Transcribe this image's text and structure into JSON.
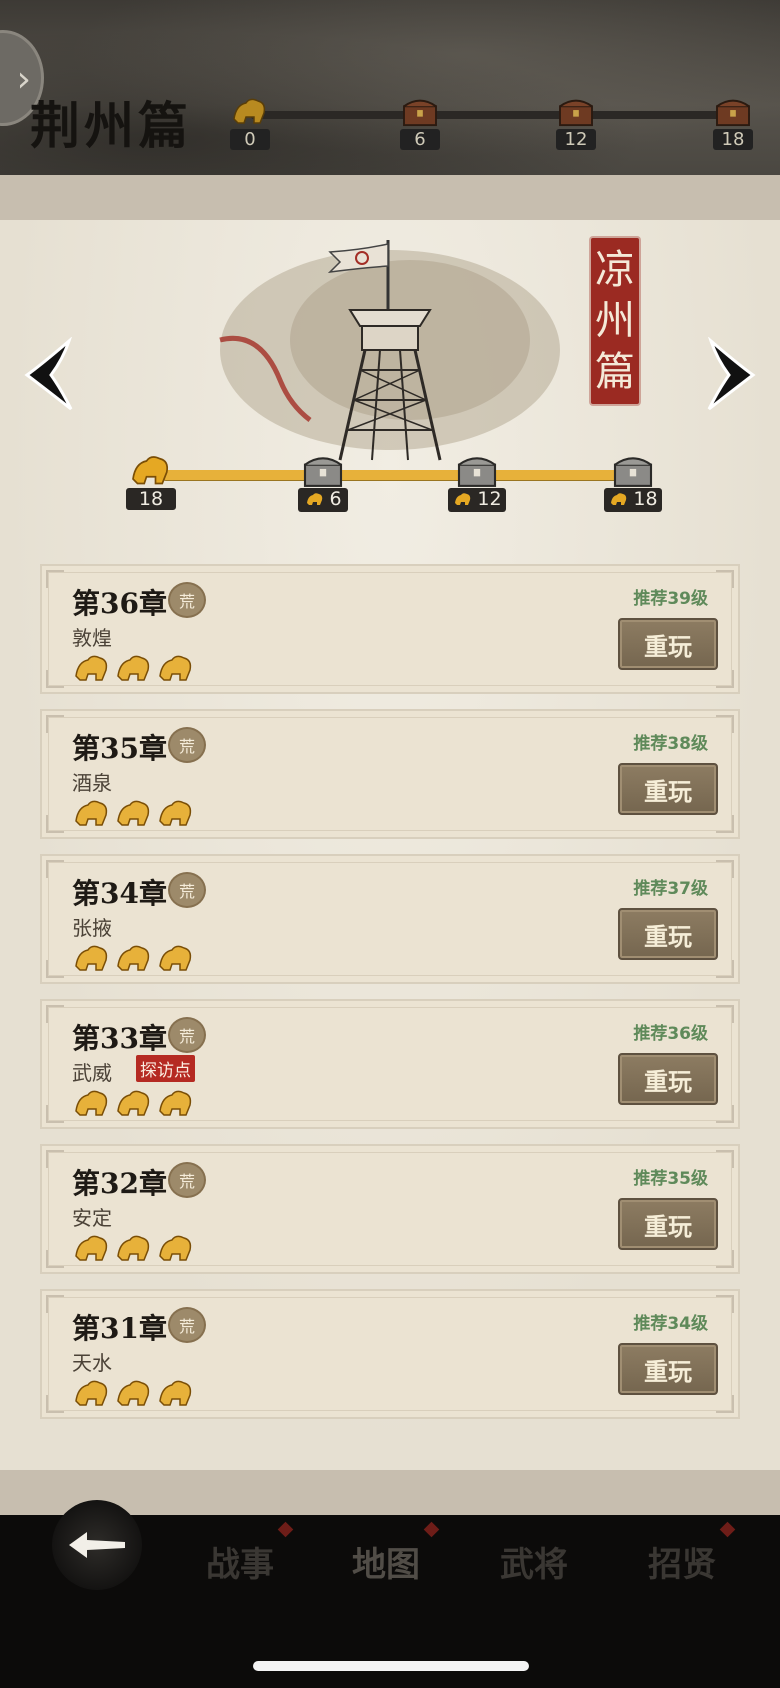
{
  "top_banner": {
    "chapter_title": "荆州篇",
    "nodes": [
      {
        "icon": "lion-icon",
        "value": "0"
      },
      {
        "icon": "chest-icon",
        "value": "6"
      },
      {
        "icon": "chest-icon",
        "value": "12"
      },
      {
        "icon": "chest-icon",
        "value": "18"
      }
    ]
  },
  "section": {
    "seal": [
      "凉",
      "州",
      "篇"
    ],
    "progress": {
      "current": "18",
      "milestones": [
        "6",
        "12",
        "18"
      ]
    }
  },
  "chapters": [
    {
      "title": "第36章",
      "difficulty": "荒",
      "place": "敦煌",
      "recommend": "推荐39级",
      "stars": 3,
      "tag": "",
      "button": "重玩"
    },
    {
      "title": "第35章",
      "difficulty": "荒",
      "place": "酒泉",
      "recommend": "推荐38级",
      "stars": 3,
      "tag": "",
      "button": "重玩"
    },
    {
      "title": "第34章",
      "difficulty": "荒",
      "place": "张掖",
      "recommend": "推荐37级",
      "stars": 3,
      "tag": "",
      "button": "重玩"
    },
    {
      "title": "第33章",
      "difficulty": "荒",
      "place": "武威",
      "recommend": "推荐36级",
      "stars": 3,
      "tag": "探访点",
      "button": "重玩"
    },
    {
      "title": "第32章",
      "difficulty": "荒",
      "place": "安定",
      "recommend": "推荐35级",
      "stars": 3,
      "tag": "",
      "button": "重玩"
    },
    {
      "title": "第31章",
      "difficulty": "荒",
      "place": "天水",
      "recommend": "推荐34级",
      "stars": 3,
      "tag": "",
      "button": "重玩"
    }
  ],
  "bottom_nav": {
    "tabs": [
      "战事",
      "地图",
      "武将",
      "招贤"
    ],
    "active": "地图"
  },
  "colors": {
    "accent_gold": "#e7b13a",
    "seal_red": "#9b2a22",
    "recommend_green": "#5f8a5a",
    "tag_red": "#b52a22"
  }
}
